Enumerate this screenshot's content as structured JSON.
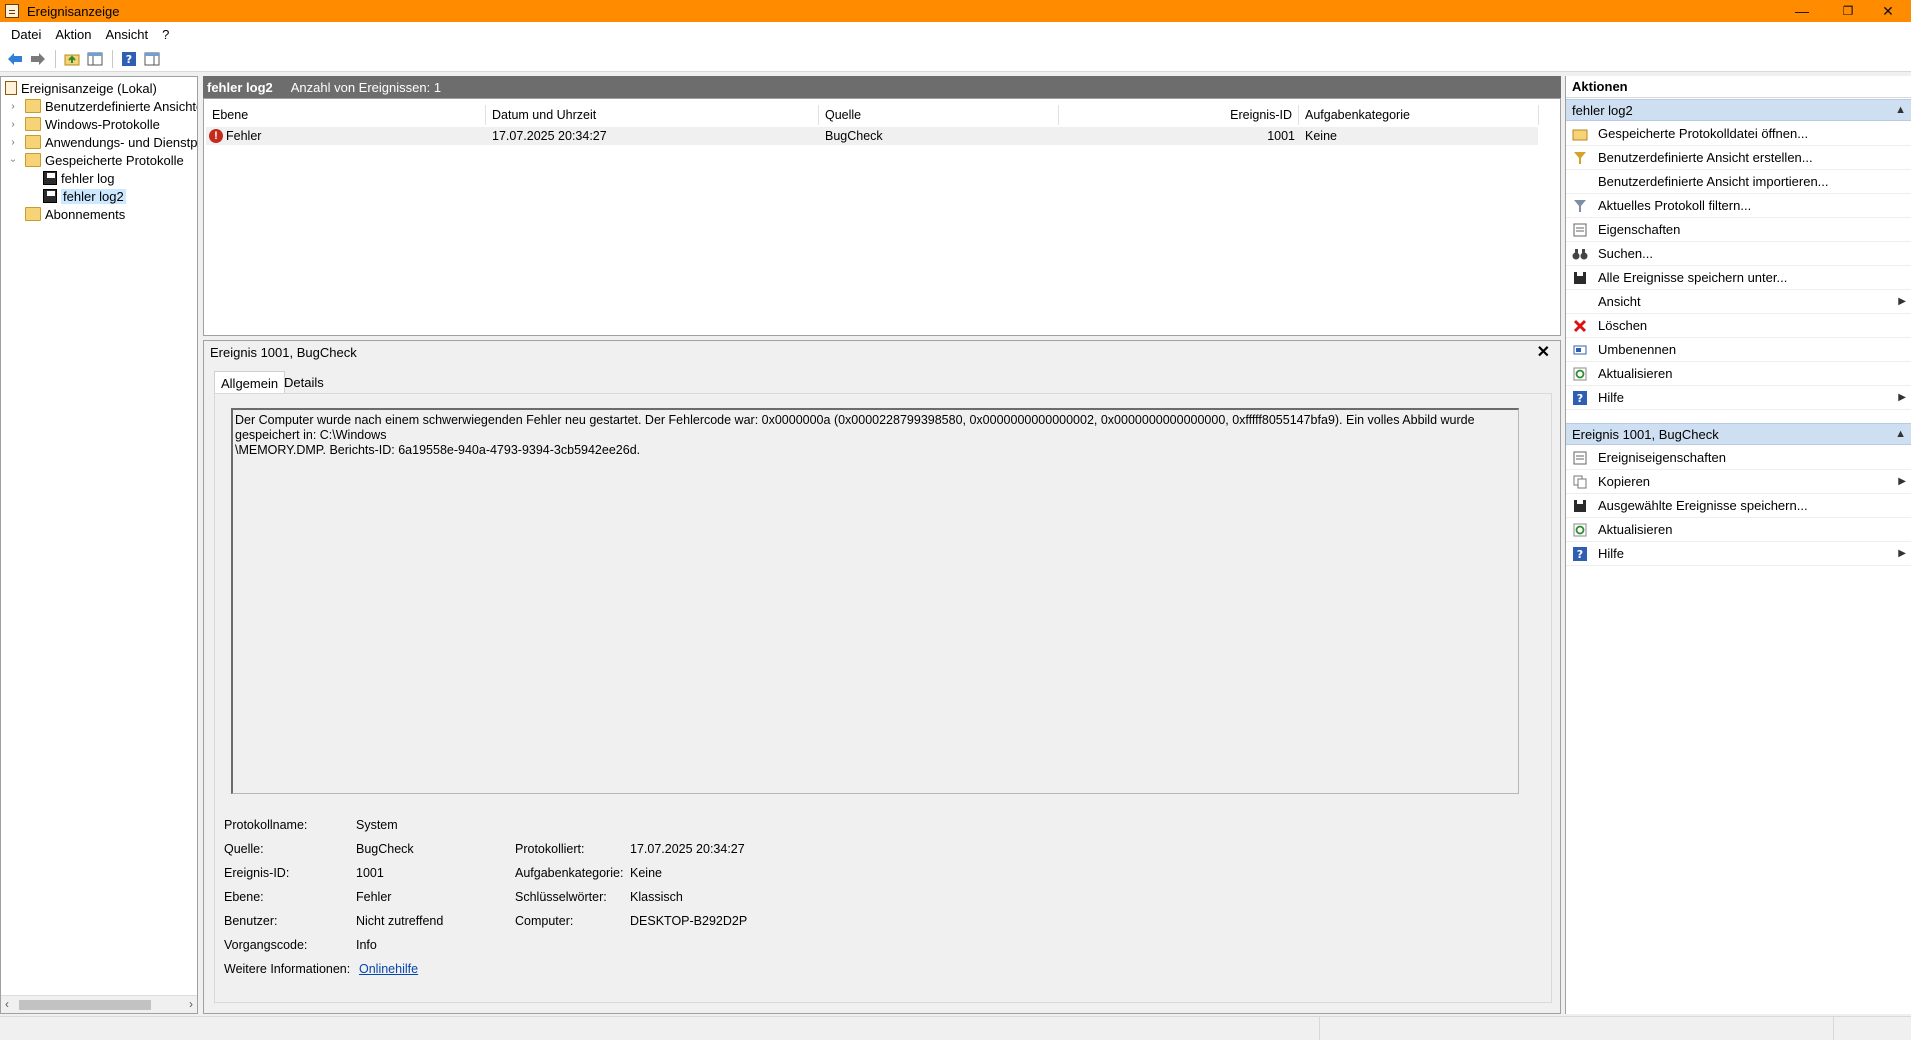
{
  "window": {
    "title": "Ereignisanzeige",
    "minimize": "—",
    "restore": "❐",
    "close": "✕"
  },
  "menu": [
    "Datei",
    "Aktion",
    "Ansicht",
    "?"
  ],
  "tree": {
    "root": "Ereignisanzeige (Lokal)",
    "items": [
      "Benutzerdefinierte Ansichten",
      "Windows-Protokolle",
      "Anwendungs- und Dienstprotokolle",
      "Gespeicherte Protokolle",
      "fehler log",
      "fehler log2",
      "Abonnements"
    ]
  },
  "list": {
    "name": "fehler log2",
    "count_label": "Anzahl von Ereignissen: 1",
    "columns": [
      "Ebene",
      "Datum und Uhrzeit",
      "Quelle",
      "Ereignis-ID",
      "Aufgabenkategorie"
    ],
    "rows": [
      {
        "level": "Fehler",
        "datetime": "17.07.2025 20:34:27",
        "source": "BugCheck",
        "id": "1001",
        "category": "Keine"
      }
    ]
  },
  "detail": {
    "title": "Ereignis 1001, BugCheck",
    "tabs": [
      "Allgemein",
      "Details"
    ],
    "message": "Der Computer wurde nach einem schwerwiegenden Fehler neu gestartet. Der Fehlercode war: 0x0000000a (0x0000228799398580, 0x0000000000000002, 0x0000000000000000, 0xfffff8055147bfa9). Ein volles Abbild wurde gespeichert in: C:\\Windows\n\\MEMORY.DMP. Berichts-ID: 6a19558e-940a-4793-9394-3cb5942ee26d.",
    "labels": {
      "log_name": "Protokollname:",
      "source": "Quelle:",
      "event_id": "Ereignis-ID:",
      "level": "Ebene:",
      "user": "Benutzer:",
      "opcode": "Vorgangscode:",
      "more_info": "Weitere Informationen:",
      "logged": "Protokolliert:",
      "task_category": "Aufgabenkategorie:",
      "keywords": "Schlüsselwörter:",
      "computer": "Computer:"
    },
    "values": {
      "log_name": "System",
      "source": "BugCheck",
      "event_id": "1001",
      "level": "Fehler",
      "user": "Nicht zutreffend",
      "opcode": "Info",
      "more_info_link": "Onlinehilfe",
      "logged": "17.07.2025 20:34:27",
      "task_category": "Keine",
      "keywords": "Klassisch",
      "computer": "DESKTOP-B292D2P"
    }
  },
  "actions": {
    "header": "Aktionen",
    "section1": {
      "title": "fehler log2",
      "items": [
        "Gespeicherte Protokolldatei öffnen...",
        "Benutzerdefinierte Ansicht erstellen...",
        "Benutzerdefinierte Ansicht importieren...",
        "Aktuelles Protokoll filtern...",
        "Eigenschaften",
        "Suchen...",
        "Alle Ereignisse speichern unter...",
        "Ansicht",
        "Löschen",
        "Umbenennen",
        "Aktualisieren",
        "Hilfe"
      ]
    },
    "section2": {
      "title": "Ereignis 1001, BugCheck",
      "items": [
        "Ereigniseigenschaften",
        "Kopieren",
        "Ausgewählte Ereignisse speichern...",
        "Aktualisieren",
        "Hilfe"
      ]
    }
  },
  "colors": {
    "titlebar": "#ff8c00",
    "section_header": "#cfdff2",
    "error": "#c42b1c",
    "link": "#0645ad"
  }
}
